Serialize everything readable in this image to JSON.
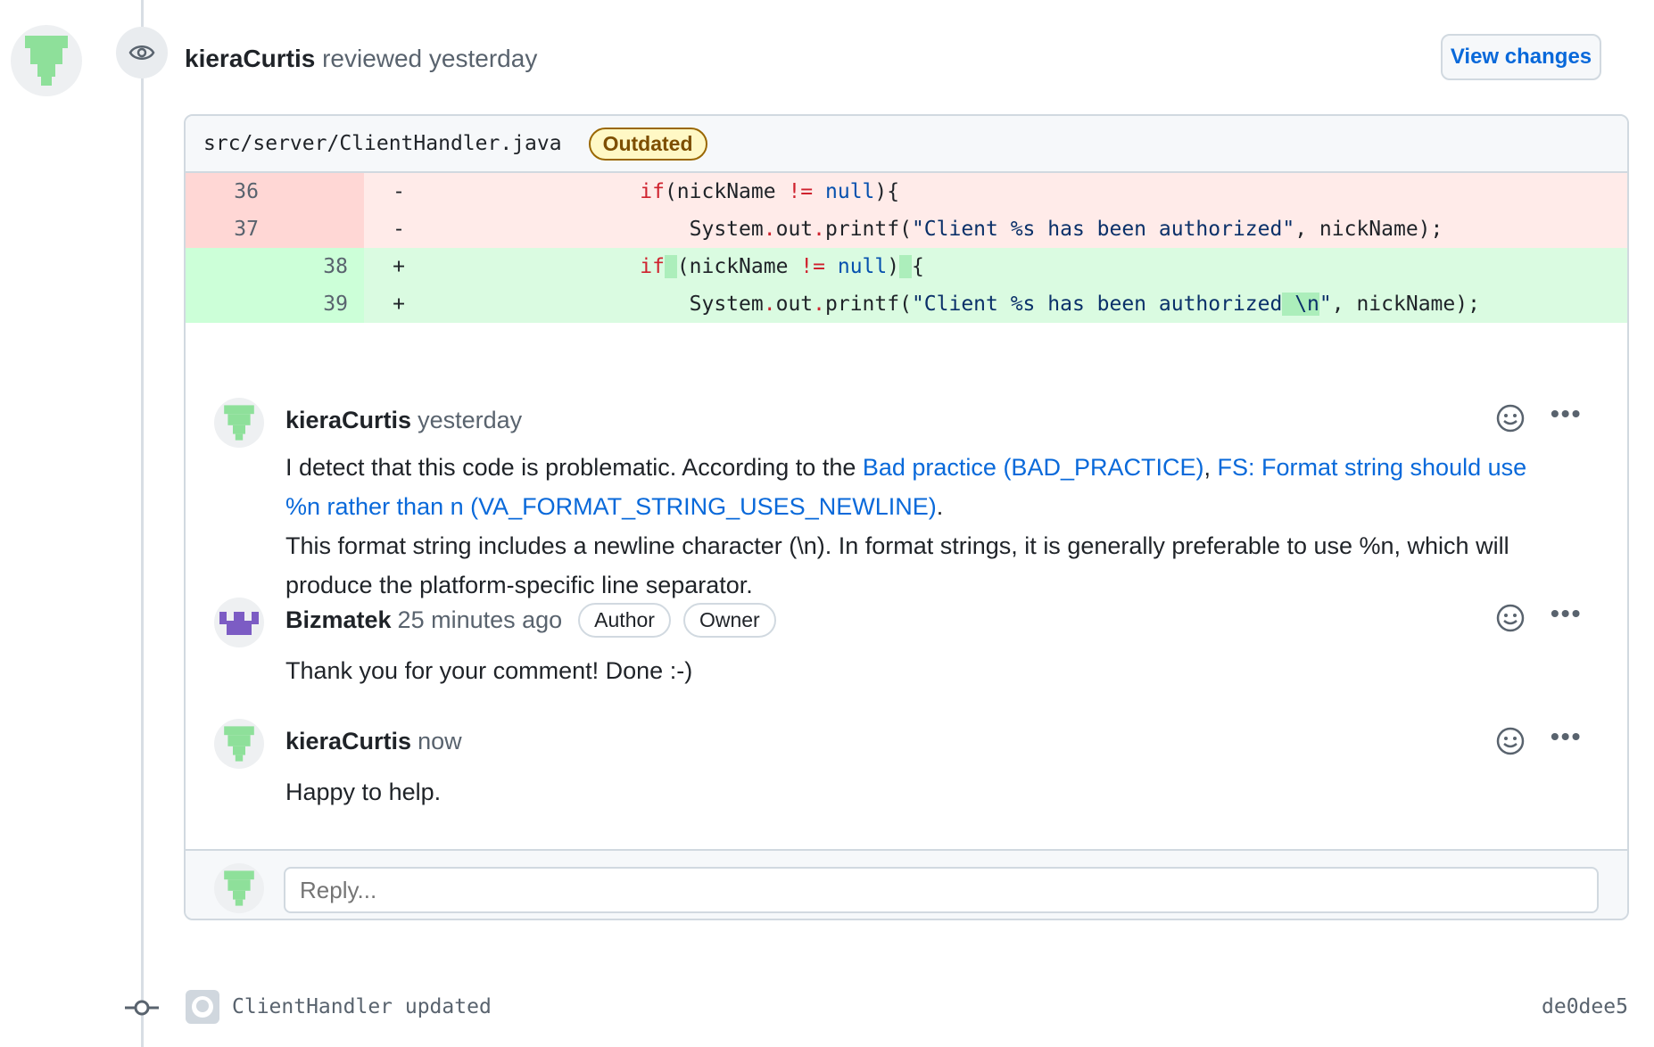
{
  "review": {
    "reviewer": "kieraCurtis",
    "action": "reviewed",
    "time": "yesterday",
    "view_changes_label": "View changes"
  },
  "file": {
    "path": "src/server/ClientHandler.java",
    "status_badge": "Outdated"
  },
  "diff": [
    {
      "type": "del",
      "old": "36",
      "new": "",
      "sign": "-"
    },
    {
      "type": "del",
      "old": "37",
      "new": "",
      "sign": "-"
    },
    {
      "type": "add",
      "old": "",
      "new": "38",
      "sign": "+"
    },
    {
      "type": "add",
      "old": "",
      "new": "39",
      "sign": "+"
    }
  ],
  "comments": [
    {
      "author": "kieraCurtis",
      "time": "yesterday",
      "text_intro": "I detect that this code is problematic. According to the ",
      "link1": "Bad practice (BAD_PRACTICE)",
      "sep": ", ",
      "link2": "FS: Format string should use %n rather than n (VA_FORMAT_STRING_USES_NEWLINE)",
      "text_end": ".",
      "text_detail": "This format string includes a newline character (\\n). In format strings, it is generally preferable to use %n, which will produce the platform-specific line separator."
    },
    {
      "author": "Bizmatek",
      "time": "25 minutes ago",
      "labels": [
        "Author",
        "Owner"
      ],
      "text": "Thank you for your comment! Done :-)"
    },
    {
      "author": "kieraCurtis",
      "time": "now",
      "text": "Happy to help."
    }
  ],
  "reply": {
    "placeholder": "Reply..."
  },
  "commit": {
    "message": "ClientHandler updated",
    "sha": "de0dee5"
  },
  "icons": [
    "eye-icon",
    "smiley-icon",
    "kebab-icon",
    "git-commit-icon",
    "github-icon"
  ],
  "colors": {
    "link": "#0969da",
    "deleted_bg": "#ffebe9",
    "added_bg": "#dafbe1",
    "outdated": "#9a6700"
  }
}
